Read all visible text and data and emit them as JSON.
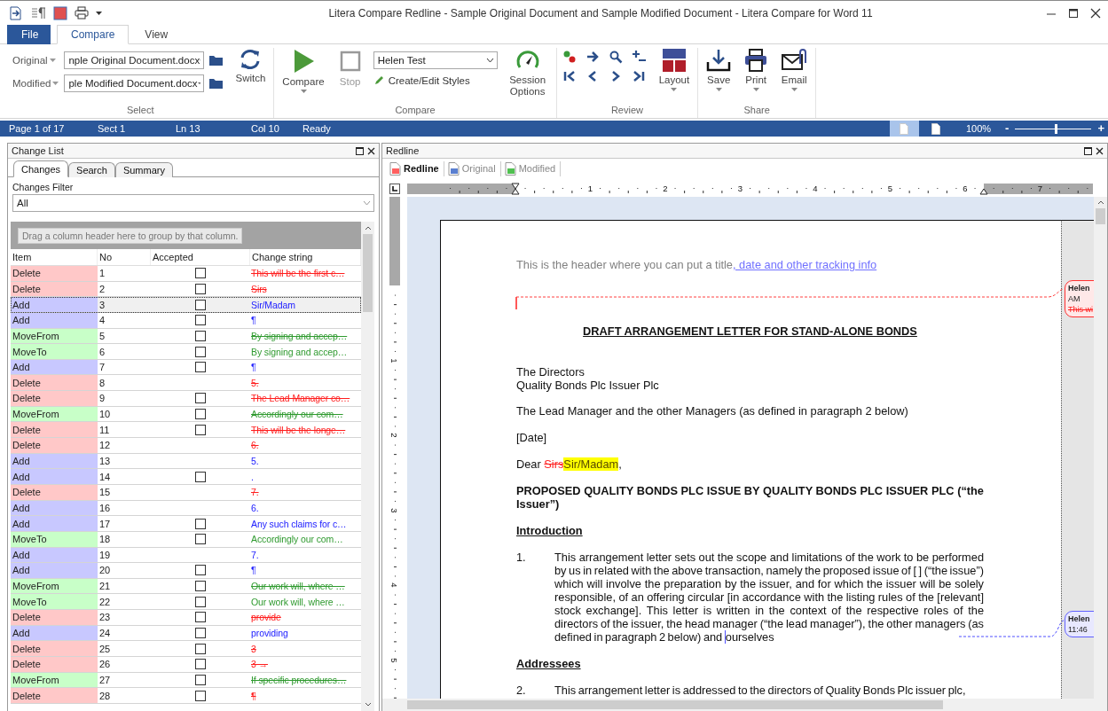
{
  "window": {
    "title": "Litera Compare Redline - Sample Original Document and Sample Modified Document -  Litera Compare for Word 11"
  },
  "ribbon_tabs": [
    {
      "label": "File",
      "kind": "file",
      "selected": false
    },
    {
      "label": "Compare",
      "kind": "tab",
      "selected": true
    },
    {
      "label": "View",
      "kind": "tab",
      "selected": false
    }
  ],
  "ribbon": {
    "select": {
      "label": "Select",
      "original_label": "Original",
      "original_value": "nple Original Document.docx",
      "modified_label": "Modified",
      "modified_value": "ple Modified Document.docx",
      "switch": "Switch"
    },
    "compare": {
      "label": "Compare",
      "compare_button": "Compare",
      "stop_button": "Stop",
      "stop_disabled": true,
      "style_value": "Helen Test",
      "styles_button": "Create/Edit Styles",
      "session_button": "Session Options"
    },
    "review": {
      "label": "Review",
      "layout_button": "Layout"
    },
    "share": {
      "label": "Share",
      "buttons": [
        {
          "label": "Save",
          "kind": "save"
        },
        {
          "label": "Print",
          "kind": "print"
        },
        {
          "label": "Email",
          "kind": "email"
        }
      ]
    }
  },
  "status_bar": {
    "fields": [
      "Page 1 of 17",
      "Sect 1",
      "Ln 13",
      "Col 10",
      "Ready"
    ],
    "views": [
      {
        "selected": true
      },
      {
        "selected": false
      }
    ],
    "zoom": "100%",
    "zoom_slider": {
      "level": 0.53
    },
    "zoom_out": "-",
    "zoom_in": "+"
  },
  "change_list": {
    "title": "Change List",
    "tabs": [
      {
        "label": "Changes",
        "selected": true
      },
      {
        "label": "Search",
        "selected": false
      },
      {
        "label": "Summary",
        "selected": false
      }
    ],
    "filter_label": "Changes Filter",
    "filter_value": "All",
    "group_hint": "Drag a column header here to group by that column.",
    "columns": [
      "Item",
      "No",
      "Accepted",
      "Change string"
    ],
    "rows": [
      {
        "item": "Delete",
        "kind": "delete",
        "no": "1",
        "accepted": false,
        "change": "This will be the first c…",
        "selected": false
      },
      {
        "item": "Delete",
        "kind": "delete",
        "no": "2",
        "accepted": false,
        "change": "Sirs",
        "selected": false
      },
      {
        "item": "Add",
        "kind": "add",
        "no": "3",
        "accepted": false,
        "change": "Sir/Madam",
        "selected": true
      },
      {
        "item": "Add",
        "kind": "add",
        "no": "4",
        "accepted": false,
        "change": "¶",
        "selected": false
      },
      {
        "item": "MoveFrom",
        "kind": "movefrom",
        "no": "5",
        "accepted": false,
        "change": "By signing and accep…",
        "selected": false
      },
      {
        "item": "MoveTo",
        "kind": "moveto",
        "no": "6",
        "accepted": false,
        "change": "By signing and accep…",
        "selected": false
      },
      {
        "item": "Add",
        "kind": "add",
        "no": "7",
        "accepted": false,
        "change": "¶",
        "selected": false
      },
      {
        "item": "Delete",
        "kind": "delete",
        "no": "8",
        "change": "5.",
        "selected": false
      },
      {
        "item": "Delete",
        "kind": "delete",
        "no": "9",
        "accepted": false,
        "change": "The Lead Manager co…",
        "selected": false
      },
      {
        "item": "MoveFrom",
        "kind": "movefrom",
        "no": "10",
        "accepted": false,
        "change": "Accordingly our com…",
        "selected": false
      },
      {
        "item": "Delete",
        "kind": "delete",
        "no": "11",
        "accepted": false,
        "change": "This will be the longe…",
        "selected": false
      },
      {
        "item": "Delete",
        "kind": "delete",
        "no": "12",
        "change": "6.",
        "selected": false
      },
      {
        "item": "Add",
        "kind": "add",
        "no": "13",
        "change": "5.",
        "selected": false
      },
      {
        "item": "Add",
        "kind": "add",
        "no": "14",
        "accepted": false,
        "change": ".",
        "selected": false
      },
      {
        "item": "Delete",
        "kind": "delete",
        "no": "15",
        "change": "7.",
        "selected": false
      },
      {
        "item": "Add",
        "kind": "add",
        "no": "16",
        "change": "6.",
        "selected": false
      },
      {
        "item": "Add",
        "kind": "add",
        "no": "17",
        "accepted": false,
        "change": "Any such claims for c…",
        "selected": false
      },
      {
        "item": "MoveTo",
        "kind": "moveto",
        "no": "18",
        "accepted": false,
        "change": "Accordingly our com…",
        "selected": false
      },
      {
        "item": "Add",
        "kind": "add",
        "no": "19",
        "change": "7.",
        "selected": false
      },
      {
        "item": "Add",
        "kind": "add",
        "no": "20",
        "accepted": false,
        "change": "¶",
        "selected": false
      },
      {
        "item": "MoveFrom",
        "kind": "movefrom",
        "no": "21",
        "accepted": false,
        "change": "Our work will, where …",
        "selected": false
      },
      {
        "item": "MoveTo",
        "kind": "moveto",
        "no": "22",
        "accepted": false,
        "change": "Our work will, where …",
        "selected": false
      },
      {
        "item": "Delete",
        "kind": "delete",
        "no": "23",
        "accepted": false,
        "change": "provide",
        "selected": false
      },
      {
        "item": "Add",
        "kind": "add",
        "no": "24",
        "accepted": false,
        "change": "providing",
        "selected": false
      },
      {
        "item": "Delete",
        "kind": "delete",
        "no": "25",
        "accepted": false,
        "change": "3",
        "selected": false
      },
      {
        "item": "Delete",
        "kind": "delete",
        "no": "26",
        "accepted": false,
        "change": "3 →",
        "selected": false
      },
      {
        "item": "MoveFrom",
        "kind": "movefrom",
        "no": "27",
        "accepted": false,
        "change": "If specific procedures…",
        "selected": false
      },
      {
        "item": "Delete",
        "kind": "delete",
        "no": "28",
        "accepted": false,
        "change": "¶",
        "selected": false
      }
    ]
  },
  "redline": {
    "title": "Redline",
    "tabs": [
      {
        "label": "Redline",
        "kind": "redline",
        "selected": true
      },
      {
        "label": "Original",
        "kind": "original",
        "selected": false
      },
      {
        "label": "Modified",
        "kind": "modified",
        "selected": false
      }
    ],
    "ruler": [
      "1",
      "2",
      "3",
      "4",
      "5",
      "6",
      "7"
    ],
    "vertical_ruler": [
      "1",
      "2",
      "3",
      "4",
      "5"
    ],
    "document": [
      {
        "kind": "header",
        "segments": [
          {
            "kind": "plain",
            "text": "This is the header where you can put a title"
          },
          {
            "kind": "insert",
            "text": ", date and other tracking info"
          }
        ]
      },
      {
        "kind": "title",
        "segments": [
          {
            "kind": "plain",
            "text": "DRAFT ARRANGEMENT LETTER FOR STAND-ALONE BONDS"
          }
        ]
      },
      {
        "kind": "address",
        "lines": [
          "The Directors",
          "Quality Bonds Plc Issuer Plc"
        ]
      },
      {
        "kind": "para",
        "segments": [
          {
            "kind": "plain",
            "text": "The Lead Manager and the other Managers (as defined in paragraph 2 below)"
          }
        ]
      },
      {
        "kind": "para",
        "segments": [
          {
            "kind": "plain",
            "text": "[Date]"
          }
        ]
      },
      {
        "kind": "para",
        "segments": [
          {
            "kind": "plain",
            "text": "Dear "
          },
          {
            "kind": "delete",
            "text": "Sirs"
          },
          {
            "kind": "highlight",
            "text": "Sir/Madam"
          },
          {
            "kind": "plain",
            "text": ","
          }
        ]
      },
      {
        "kind": "bold",
        "segments": [
          {
            "kind": "plain",
            "text": "PROPOSED QUALITY BONDS PLC ISSUE BY QUALITY BONDS PLC ISSUER PLC (“the Issuer”)"
          }
        ]
      },
      {
        "kind": "heading",
        "segments": [
          {
            "kind": "plain",
            "text": "Introduction"
          }
        ]
      },
      {
        "kind": "numbered",
        "number": "1.",
        "segments": [
          {
            "kind": "plain",
            "text": "This arrangement letter sets out the scope and limitations of the work to be performed by us in related with the above transaction, namely the proposed issue of [ ] (“the issue”) which will involve the preparation by the issuer, and for which the issuer will be solely responsible, of an offering circular [in accordance with the listing rules of the [relevant] stock exchange].  This letter is written in the context of the respective roles of the directors of the issuer, the head manager (“the lead manager”), the other managers (as defined in paragraph 2 below) and "
          },
          {
            "kind": "anchor",
            "text": "ourselves"
          }
        ]
      },
      {
        "kind": "heading",
        "segments": [
          {
            "kind": "plain",
            "text": "Addressees"
          }
        ]
      },
      {
        "kind": "numbered",
        "number": "2.",
        "segments": [
          {
            "kind": "plain",
            "text": "This arrangement letter is addressed to the directors of Quality Bonds Plc issuer plc,"
          }
        ]
      }
    ],
    "comments": [
      {
        "kind": "delete",
        "author": "Helen",
        "lines": [
          "AM"
        ],
        "excerpt": "This wi"
      },
      {
        "kind": "add",
        "author": "Helen",
        "lines": [
          "11:46"
        ]
      }
    ]
  }
}
